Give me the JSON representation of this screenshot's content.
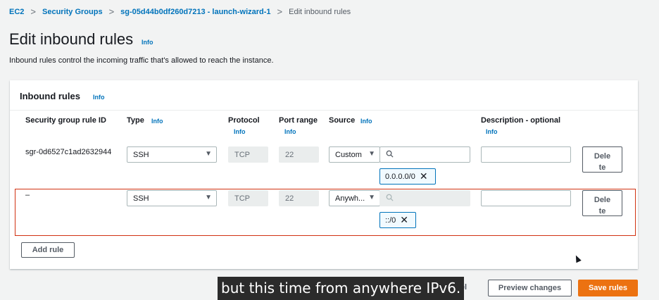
{
  "breadcrumb": {
    "items": [
      "EC2",
      "Security Groups",
      "sg-05d44b0df260d7213 - launch-wizard-1"
    ],
    "current": "Edit inbound rules",
    "separator": ">"
  },
  "page": {
    "title": "Edit inbound rules",
    "info": "Info",
    "description": "Inbound rules control the incoming traffic that's allowed to reach the instance."
  },
  "panel": {
    "title": "Inbound rules",
    "info": "Info",
    "columns": {
      "rule_id": "Security group rule ID",
      "type": "Type",
      "type_info": "Info",
      "protocol": "Protocol",
      "protocol_info": "Info",
      "port_range": "Port range",
      "port_info": "Info",
      "source": "Source",
      "source_info": "Info",
      "description": "Description - optional",
      "description_info": "Info"
    },
    "rows": [
      {
        "rule_id": "sgr-0d6527c1ad2632944",
        "type": "SSH",
        "protocol": "TCP",
        "port_range": "22",
        "source": "Custom",
        "cidr_token": "0.0.0.0/0",
        "description": "",
        "delete_line1": "Dele",
        "delete_line2": "te"
      },
      {
        "rule_id": "–",
        "type": "SSH",
        "protocol": "TCP",
        "port_range": "22",
        "source": "Anywh...",
        "cidr_token": "::/0",
        "description": "",
        "delete_line1": "Dele",
        "delete_line2": "te"
      }
    ],
    "add_rule": "Add rule"
  },
  "footer": {
    "cancel": "ncel",
    "preview": "Preview changes",
    "save": "Save rules"
  },
  "caption": "but this time from anywhere IPv6.",
  "colors": {
    "link": "#0073bb",
    "primary": "#ec7211",
    "highlight": "#d13212",
    "token_border": "#0073bb"
  },
  "icons": {
    "caret": "▼",
    "close": "✕",
    "search": "search-icon"
  }
}
